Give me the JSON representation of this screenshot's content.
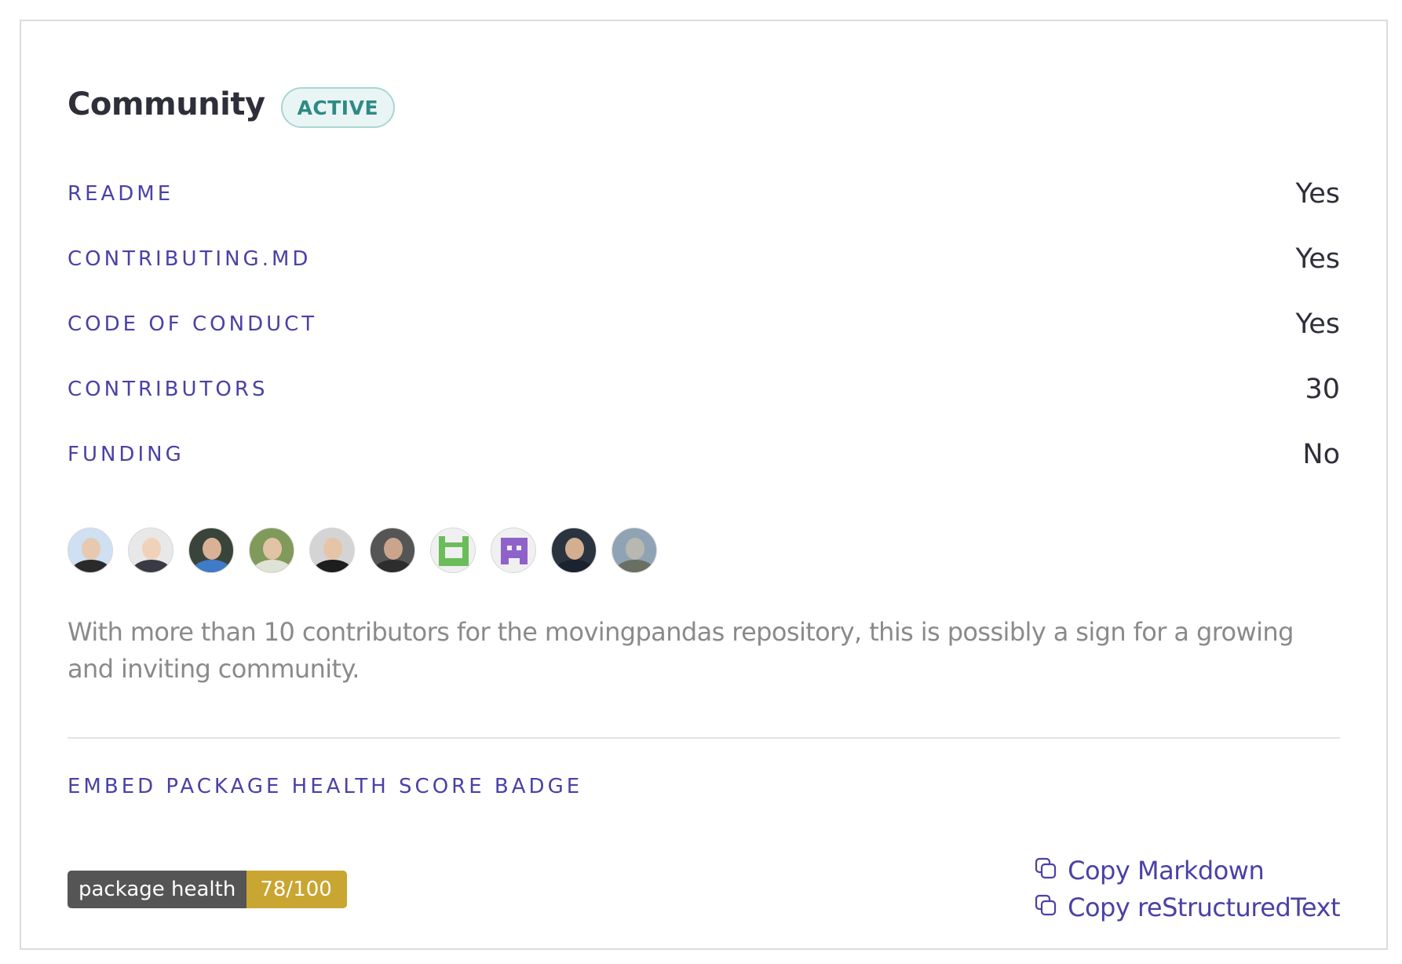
{
  "card": {
    "title": "Community",
    "status_badge": "ACTIVE",
    "rows": [
      {
        "label": "README",
        "value": "Yes"
      },
      {
        "label": "CONTRIBUTING.MD",
        "value": "Yes"
      },
      {
        "label": "CODE OF CONDUCT",
        "value": "Yes"
      },
      {
        "label": "CONTRIBUTORS",
        "value": "30"
      },
      {
        "label": "FUNDING",
        "value": "No"
      }
    ],
    "contributor_avatars": [
      {
        "icon": "person-avatar-icon",
        "bg": "#cfe0f2",
        "head": "#e7c9b0",
        "body": "#2a2a2a"
      },
      {
        "icon": "person-avatar-icon",
        "bg": "#e8e8e8",
        "head": "#f0d2bb",
        "body": "#3a3a45"
      },
      {
        "icon": "person-avatar-icon",
        "bg": "#39443b",
        "head": "#d8b197",
        "body": "#3f7cc7"
      },
      {
        "icon": "person-avatar-icon",
        "bg": "#7f9a5a",
        "head": "#e2c3a6",
        "body": "#dfe3d5"
      },
      {
        "icon": "person-avatar-icon",
        "bg": "#d4d4d4",
        "head": "#e6c4a8",
        "body": "#1d1d1d"
      },
      {
        "icon": "person-avatar-icon",
        "bg": "#555555",
        "head": "#caa58c",
        "body": "#2d2d2d"
      },
      {
        "icon": "identicon-green-icon",
        "bg": "#f0f0f0",
        "color": "#6bbd5b"
      },
      {
        "icon": "identicon-purple-icon",
        "bg": "#f0f0f0",
        "color": "#8e62c9"
      },
      {
        "icon": "person-avatar-icon",
        "bg": "#2a3340",
        "head": "#d3ae90",
        "body": "#1b2230"
      },
      {
        "icon": "landscape-avatar-icon",
        "bg": "#8fa3b5",
        "head": "#b8b8b0",
        "body": "#6a6f64"
      }
    ],
    "description": "With more than 10 contributors for the movingpandas repository, this is possibly a sign for a growing and inviting community.",
    "embed": {
      "title": "EMBED PACKAGE HEALTH SCORE BADGE",
      "shield_label": "package health",
      "shield_value": "78/100",
      "copy_markdown": "Copy Markdown",
      "copy_rst": "Copy reStructuredText"
    }
  },
  "colors": {
    "accent": "#4a41a6",
    "badge_text": "#2f8a86",
    "badge_bg": "#e9f5f4",
    "value_text": "#2f2f3a",
    "muted_text": "#8a8a8a",
    "shield_left": "#555555",
    "shield_right": "#c9a531"
  }
}
